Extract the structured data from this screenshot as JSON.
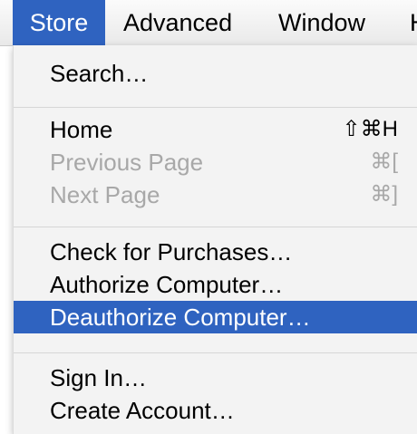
{
  "menubar": {
    "items": [
      {
        "label": "Store",
        "active": true
      },
      {
        "label": "Advanced",
        "active": false
      },
      {
        "label": "Window",
        "active": false
      },
      {
        "label": "H",
        "active": false
      }
    ]
  },
  "store_menu": {
    "items": [
      {
        "label": "Search…",
        "shortcut": "",
        "enabled": true,
        "highlighted": false
      },
      {
        "label": "Home",
        "shortcut": "⇧⌘H",
        "enabled": true,
        "highlighted": false
      },
      {
        "label": "Previous Page",
        "shortcut": "⌘[",
        "enabled": false,
        "highlighted": false
      },
      {
        "label": "Next Page",
        "shortcut": "⌘]",
        "enabled": false,
        "highlighted": false
      },
      {
        "label": "Check for Purchases…",
        "shortcut": "",
        "enabled": true,
        "highlighted": false
      },
      {
        "label": "Authorize Computer…",
        "shortcut": "",
        "enabled": true,
        "highlighted": false
      },
      {
        "label": "Deauthorize Computer…",
        "shortcut": "",
        "enabled": true,
        "highlighted": true
      },
      {
        "label": "Sign In…",
        "shortcut": "",
        "enabled": true,
        "highlighted": false
      },
      {
        "label": "Create Account…",
        "shortcut": "",
        "enabled": true,
        "highlighted": false
      }
    ]
  },
  "colors": {
    "highlight": "#2f63c0",
    "disabled_text": "#a8a8a8",
    "menu_bg": "#f3f3f3"
  }
}
